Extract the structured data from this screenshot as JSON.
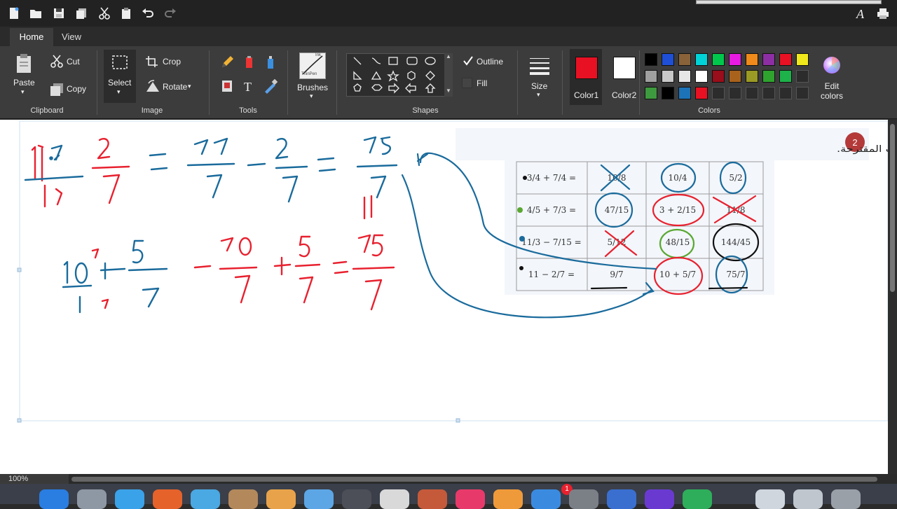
{
  "tabs": {
    "home": "Home",
    "view": "View"
  },
  "clipboard": {
    "paste": "Paste",
    "cut": "Cut",
    "copy": "Copy",
    "label": "Clipboard"
  },
  "image": {
    "select": "Select",
    "crop": "Crop",
    "rotate": "Rotate",
    "label": "Image"
  },
  "tools": {
    "label": "Tools"
  },
  "brushes": {
    "label": "Brushes",
    "thumb_text_1": "Ink",
    "thumb_text_2": "ThinPen"
  },
  "shapes": {
    "outline": "Outline",
    "fill": "Fill",
    "label": "Shapes"
  },
  "size": {
    "label": "Size"
  },
  "color1": {
    "label": "Color1",
    "value": "#e81123"
  },
  "color2": {
    "label": "Color2",
    "value": "#ffffff"
  },
  "colors": {
    "label": "Colors",
    "edit": "Edit colors",
    "row1": [
      "#000000",
      "#1f4fd6",
      "#8a6239",
      "#00d2d8",
      "#00c84c",
      "#e81be2",
      "#f08a1a",
      "#8e2ea5",
      "#e81123",
      "#f0e81a"
    ],
    "row2": [
      "#a0a0a0",
      "#c8c8c8",
      "#e6e6e6",
      "#ffffff",
      "#9a0d1a",
      "#a9621b",
      "#9a9a24",
      "#2ea32e",
      "#1db24a",
      null
    ],
    "row3": [
      "#3e9a3e",
      "#000000",
      "#1d73b8",
      "#e81123",
      null,
      null,
      null,
      null,
      null,
      null
    ]
  },
  "status": {
    "zoom": "100%"
  },
  "drawing": {
    "ink_colors": {
      "red": "#e8212f",
      "blue": "#1a6b9c",
      "black": "#111111",
      "green": "#5aa832"
    },
    "row1": {
      "lhs": "11·7 / 1·7",
      "fraction_2_7": "2/7",
      "eq1": "=",
      "fraction_77_7": "77/7",
      "minus": "-",
      "fraction_2_7b": "2/7",
      "eq2": "=",
      "fraction_75_7": "75/7",
      "side_note": "11"
    },
    "row2": {
      "lhs": "10·7 / 1·7",
      "plus": "+",
      "fraction_5_7": "5/7",
      "eq1": "=",
      "fraction_70_7": "70/7",
      "plus2": "+",
      "fraction_5_7b": "5/7",
      "eq2": "=",
      "fraction_75_7": "75/7"
    },
    "exercise": {
      "number": "2",
      "instruction": "حدّد بالنسبة لكلّ واد الإجابة أو الإجابات الصحيحة من بين الثّلاث إجابات المقترحة.",
      "rows": [
        {
          "expr": "3/4 + 7/4 =",
          "a": "10/8",
          "b": "10/4",
          "c": "5/2"
        },
        {
          "expr": "4/5 + 7/3 =",
          "a": "47/15",
          "b": "3 + 2/15",
          "c": "11/8"
        },
        {
          "expr": "11/3 − 7/15 =",
          "a": "5/12",
          "b": "48/15",
          "c": "144/45"
        },
        {
          "expr": "11 − 2/7 =",
          "a": "9/7",
          "b": "10 + 5/7",
          "c": "75/7"
        }
      ]
    }
  }
}
